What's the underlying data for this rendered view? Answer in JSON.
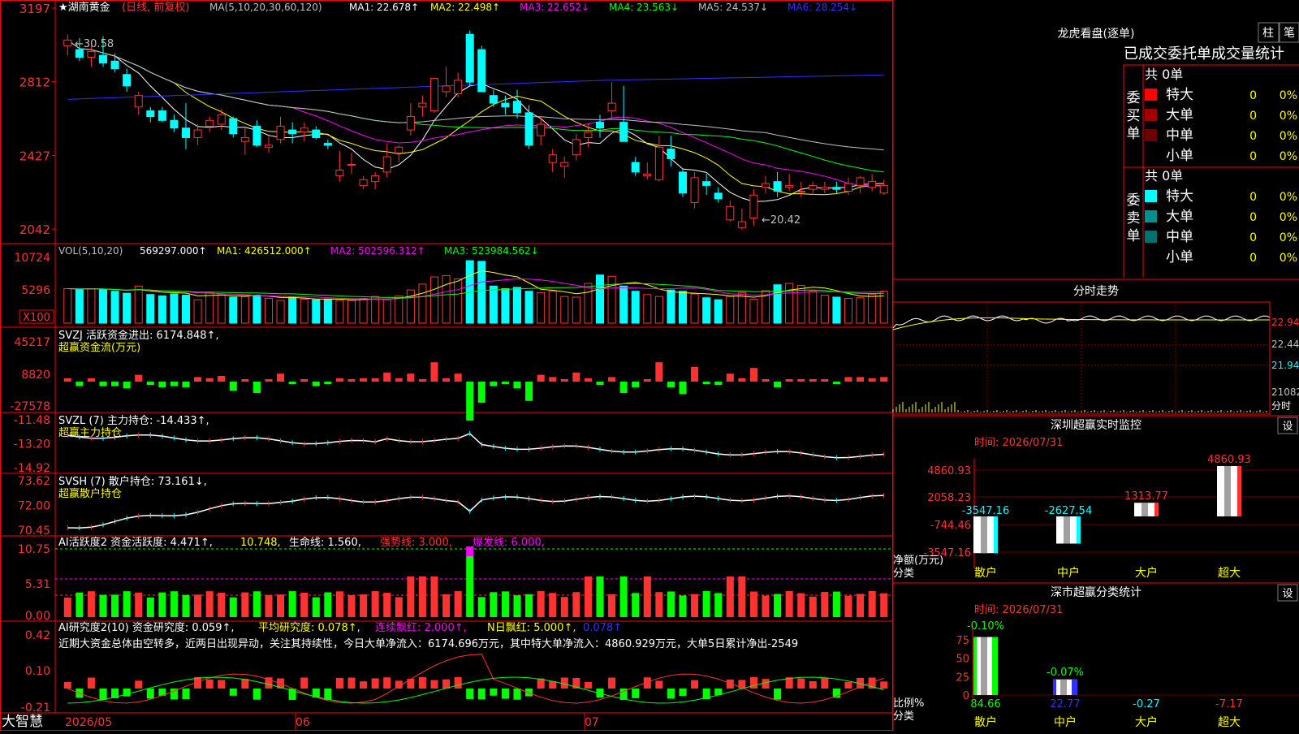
{
  "stock": {
    "name": "湖南黄金",
    "mode": "(日线, 前复权)",
    "star": "★"
  },
  "main_legend": {
    "ma_head": "MA(5,10,20,30,60,120)",
    "items": [
      {
        "label": "MA1:",
        "value": "22.678",
        "arrow": "↑",
        "color": "#ffffff"
      },
      {
        "label": "MA2:",
        "value": "22.498",
        "arrow": "↑",
        "color": "#ffff00"
      },
      {
        "label": "MA3:",
        "value": "22.652",
        "arrow": "↓",
        "color": "#ff00ff"
      },
      {
        "label": "MA4:",
        "value": "23.563",
        "arrow": "↓",
        "color": "#00ff00"
      },
      {
        "label": "MA5:",
        "value": "24.537",
        "arrow": "↓",
        "color": "#c0c0c0"
      },
      {
        "label": "MA6:",
        "value": "28.254",
        "arrow": "↓",
        "color": "#3030ff"
      }
    ]
  },
  "main_axis": [
    "3197",
    "2812",
    "2427",
    "2042"
  ],
  "annotations": {
    "high": "←30.58",
    "low": "←20.42"
  },
  "vol": {
    "axis": [
      "10724",
      "5296",
      "X100"
    ],
    "head": "VOL(5,10,20)",
    "items": [
      {
        "label": "",
        "value": "569297.000",
        "arrow": "↑",
        "color": "#ffffff"
      },
      {
        "label": "MA1:",
        "value": "426512.000",
        "arrow": "↑",
        "color": "#ffff00"
      },
      {
        "label": "MA2:",
        "value": "502596.312",
        "arrow": "↑",
        "color": "#ff00ff"
      },
      {
        "label": "MA3:",
        "value": "523984.562",
        "arrow": "↓",
        "color": "#00ff00"
      }
    ]
  },
  "svzj": {
    "axis": [
      "45217",
      "8820",
      "-27578"
    ],
    "line1": "SVZJ  活跃资金进出: 6174.848↑,",
    "line2": "超赢资金流(万元)"
  },
  "svzl": {
    "axis": [
      "-11.48",
      "-13.20",
      "-14.92"
    ],
    "line1": "SVZL (7) 主力持仓: -14.433↑,",
    "line2": "超赢主力持仓"
  },
  "svsh": {
    "axis": [
      "73.62",
      "72.00",
      "70.45"
    ],
    "line1": "SVSH (7) 散户持仓: 73.161↓,",
    "line2": "超赢散户持仓"
  },
  "ai1": {
    "axis": [
      "10.75",
      "5.31",
      "0.00"
    ],
    "head": "AI活跃度2 资金活跃度: 4.471↑,",
    "v2": "10.748,",
    "v3": "生命线: 1.560,",
    "v4": "强势线: 3.000,",
    "v5": "爆发线: 6.000,"
  },
  "ai2": {
    "axis": [
      "0.42",
      "0.10",
      "-0.21"
    ],
    "head": "AI研究度2(10) 资金研究度: 0.059↑,",
    "v2": "平均研究度: 0.078↑,",
    "v3": "连续飘红: 2.000↑,",
    "v4": "N日飘红: 5.000↑,",
    "v5": "0.078↑",
    "note": "近期大资金总体由空转多，近两日出现异动，关注其持续性，今日大单净流入：6174.696万元，其中特大单净流入：4860.929万元，大单5日累计净出-2549"
  },
  "date_axis": [
    "2026/05",
    "06",
    "07"
  ],
  "brand": "大智慧",
  "right": {
    "dragon_title": "龙虎看盘(逐单)",
    "tab_bar": "柱",
    "tab_pen": "笔",
    "stat_header": "已成交委托单成交量统计",
    "buy_label": "委买单",
    "sell_label": "委卖单",
    "buy_total": "共 0单",
    "sell_total": "共 0单",
    "buy_rows": [
      {
        "name": "特大",
        "num": "0",
        "pct": "0%",
        "color": "#ff0000"
      },
      {
        "name": "大单",
        "num": "0",
        "pct": "0%",
        "color": "#a00000"
      },
      {
        "name": "中单",
        "num": "0",
        "pct": "0%",
        "color": "#700000"
      },
      {
        "name": "小单",
        "num": "0",
        "pct": "0%",
        "color": ""
      }
    ],
    "sell_rows": [
      {
        "name": "特大",
        "num": "0",
        "pct": "0%",
        "color": "#00ffff"
      },
      {
        "name": "大单",
        "num": "0",
        "pct": "0%",
        "color": "#009090"
      },
      {
        "name": "中单",
        "num": "0",
        "pct": "0%",
        "color": "#007070"
      },
      {
        "name": "小单",
        "num": "0",
        "pct": "0%",
        "color": ""
      }
    ],
    "intraday": {
      "title": "分时走势",
      "axis": [
        "22.94",
        "22.44",
        "21.94",
        "21082",
        "分时"
      ]
    },
    "monitor": {
      "title": "深圳超赢实时监控",
      "set": "设",
      "time": "时间: 2026/07/31",
      "axis": [
        "4860.93",
        "2058.23",
        "-744.46",
        "-3547.16"
      ],
      "ylab": "净额(万元)",
      "xlab": "分类",
      "categories": [
        "散户",
        "中户",
        "大户",
        "超大"
      ],
      "value_labels": [
        "-3547.16",
        "-2627.54",
        "1313.77",
        "4860.93"
      ],
      "values": [
        -3547.16,
        -2627.54,
        1313.77,
        4860.93
      ]
    },
    "classify": {
      "title": "深市超赢分类统计",
      "set": "设",
      "time": "时间: 2026/07/31",
      "axis": [
        "75",
        "50",
        "25",
        "0"
      ],
      "ylab": "比例%",
      "xlab": "分类",
      "categories": [
        "散户",
        "中户",
        "大户",
        "超大"
      ],
      "top_labels": [
        "-0.10%",
        "-0.07%"
      ],
      "bottom_labels": [
        "84.66",
        "22.77",
        "-0.27",
        "-7.17"
      ],
      "values": [
        84.66,
        22.77,
        -0.27,
        -7.17
      ]
    }
  },
  "colors": {
    "up": "#ff3232",
    "down": "#00ffff",
    "border": "#ff0000",
    "axis_text": "#ff3232"
  },
  "chart_data": [
    {
      "type": "candlestick",
      "title": "湖南黄金 (日线, 前复权)",
      "x_start": "2026/05",
      "x_ticks": [
        "2026/05",
        "06",
        "07"
      ],
      "ylim": [
        20.0,
        31.97
      ],
      "high_label": 30.58,
      "low_label": 20.42,
      "ohlc": [
        [
          30.0,
          30.6,
          29.5,
          30.3
        ],
        [
          29.8,
          30.4,
          29.2,
          29.4
        ],
        [
          29.4,
          30.0,
          28.9,
          29.7
        ],
        [
          29.5,
          30.5,
          28.9,
          29.1
        ],
        [
          29.2,
          29.6,
          28.6,
          28.8
        ],
        [
          28.5,
          28.8,
          27.6,
          27.9
        ],
        [
          26.8,
          27.6,
          26.4,
          27.4
        ],
        [
          26.6,
          26.8,
          26.0,
          26.3
        ],
        [
          26.6,
          26.8,
          26.0,
          26.1
        ],
        [
          26.1,
          26.4,
          25.5,
          25.7
        ],
        [
          25.7,
          27.0,
          24.6,
          25.2
        ],
        [
          25.2,
          25.9,
          24.8,
          25.6
        ],
        [
          25.8,
          26.3,
          25.5,
          26.1
        ],
        [
          25.9,
          26.7,
          25.6,
          26.4
        ],
        [
          26.2,
          26.3,
          25.2,
          25.4
        ],
        [
          25.0,
          25.7,
          24.3,
          25.2
        ],
        [
          25.8,
          26.1,
          24.7,
          24.8
        ],
        [
          24.7,
          25.3,
          24.4,
          24.8
        ],
        [
          25.1,
          26.3,
          24.9,
          25.8
        ],
        [
          25.6,
          26.0,
          24.9,
          25.4
        ],
        [
          25.5,
          26.0,
          25.0,
          25.7
        ],
        [
          25.6,
          25.8,
          25.1,
          25.2
        ],
        [
          24.9,
          25.1,
          24.6,
          24.8
        ],
        [
          23.2,
          24.5,
          22.9,
          23.5
        ],
        [
          23.8,
          24.4,
          23.3,
          23.8
        ],
        [
          22.7,
          23.2,
          22.5,
          23.0
        ],
        [
          22.9,
          23.4,
          22.5,
          23.2
        ],
        [
          23.4,
          24.9,
          23.1,
          24.2
        ],
        [
          24.4,
          24.8,
          23.9,
          24.7
        ],
        [
          25.6,
          27.0,
          25.3,
          26.3
        ],
        [
          26.8,
          27.4,
          26.3,
          27.0
        ],
        [
          26.6,
          28.2,
          26.5,
          28.3
        ],
        [
          27.6,
          28.9,
          27.3,
          27.9
        ],
        [
          27.5,
          28.6,
          27.3,
          28.2
        ],
        [
          30.6,
          30.8,
          27.9,
          28.1
        ],
        [
          29.8,
          30.0,
          27.8,
          27.6
        ],
        [
          27.4,
          27.7,
          26.8,
          27.0
        ],
        [
          27.0,
          27.4,
          26.4,
          26.8
        ],
        [
          27.1,
          27.7,
          26.2,
          26.5
        ],
        [
          26.5,
          26.9,
          24.6,
          24.8
        ],
        [
          25.3,
          26.3,
          24.8,
          25.9
        ],
        [
          23.9,
          24.6,
          23.4,
          24.3
        ],
        [
          23.7,
          24.2,
          23.1,
          23.9
        ],
        [
          24.3,
          25.4,
          24.0,
          25.1
        ],
        [
          25.2,
          25.9,
          24.7,
          25.5
        ],
        [
          26.0,
          26.4,
          25.2,
          25.7
        ],
        [
          26.6,
          28.1,
          26.2,
          27.0
        ],
        [
          26.0,
          27.9,
          25.4,
          25.0
        ],
        [
          23.9,
          24.2,
          23.2,
          23.4
        ],
        [
          23.2,
          23.9,
          23.0,
          23.3
        ],
        [
          23.0,
          25.3,
          22.9,
          24.7
        ],
        [
          24.6,
          25.3,
          23.7,
          24.1
        ],
        [
          23.4,
          23.6,
          22.1,
          22.3
        ],
        [
          21.8,
          23.4,
          21.5,
          23.1
        ],
        [
          22.9,
          23.3,
          22.2,
          22.7
        ],
        [
          22.3,
          22.6,
          21.8,
          22.0
        ],
        [
          20.9,
          21.9,
          20.8,
          21.6
        ],
        [
          20.5,
          21.5,
          20.4,
          20.8
        ],
        [
          21.0,
          22.5,
          20.6,
          22.2
        ],
        [
          22.6,
          23.2,
          22.3,
          22.8
        ],
        [
          22.9,
          23.4,
          22.1,
          22.4
        ],
        [
          22.6,
          23.3,
          22.4,
          22.7
        ],
        [
          22.4,
          22.9,
          22.1,
          22.4
        ],
        [
          22.5,
          22.9,
          22.2,
          22.7
        ],
        [
          22.5,
          22.9,
          22.3,
          22.6
        ],
        [
          22.6,
          22.9,
          22.3,
          22.5
        ],
        [
          22.4,
          23.1,
          22.2,
          22.8
        ],
        [
          22.7,
          23.2,
          22.3,
          23.1
        ],
        [
          22.6,
          23.3,
          22.4,
          22.9
        ],
        [
          22.3,
          23.0,
          22.2,
          22.7
        ]
      ]
    },
    {
      "type": "bar",
      "title": "VOL(5,10,20)",
      "ylabel": "X100",
      "ylim": [
        0,
        10724
      ],
      "values": [
        5296,
        5196,
        5296,
        5196,
        4896,
        4596,
        5696,
        4396,
        4196,
        4496,
        4296,
        3596,
        4696,
        4496,
        3996,
        4096,
        4296,
        3796,
        3496,
        3996,
        3696,
        3596,
        3696,
        3496,
        3496,
        3796,
        4096,
        3596,
        4196,
        5096,
        5996,
        7096,
        7296,
        6796,
        9596,
        9496,
        5696,
        5296,
        5496,
        4896,
        4696,
        4896,
        4096,
        3996,
        6096,
        7396,
        7196,
        5696,
        4896,
        4396,
        4096,
        5096,
        4896,
        4496,
        3896,
        3596,
        4096,
        4696,
        3696,
        4996,
        5896,
        6096,
        5796,
        4896,
        4296,
        3996,
        3796,
        3896,
        4396,
        4896
      ],
      "series_up": []
    }
  ]
}
